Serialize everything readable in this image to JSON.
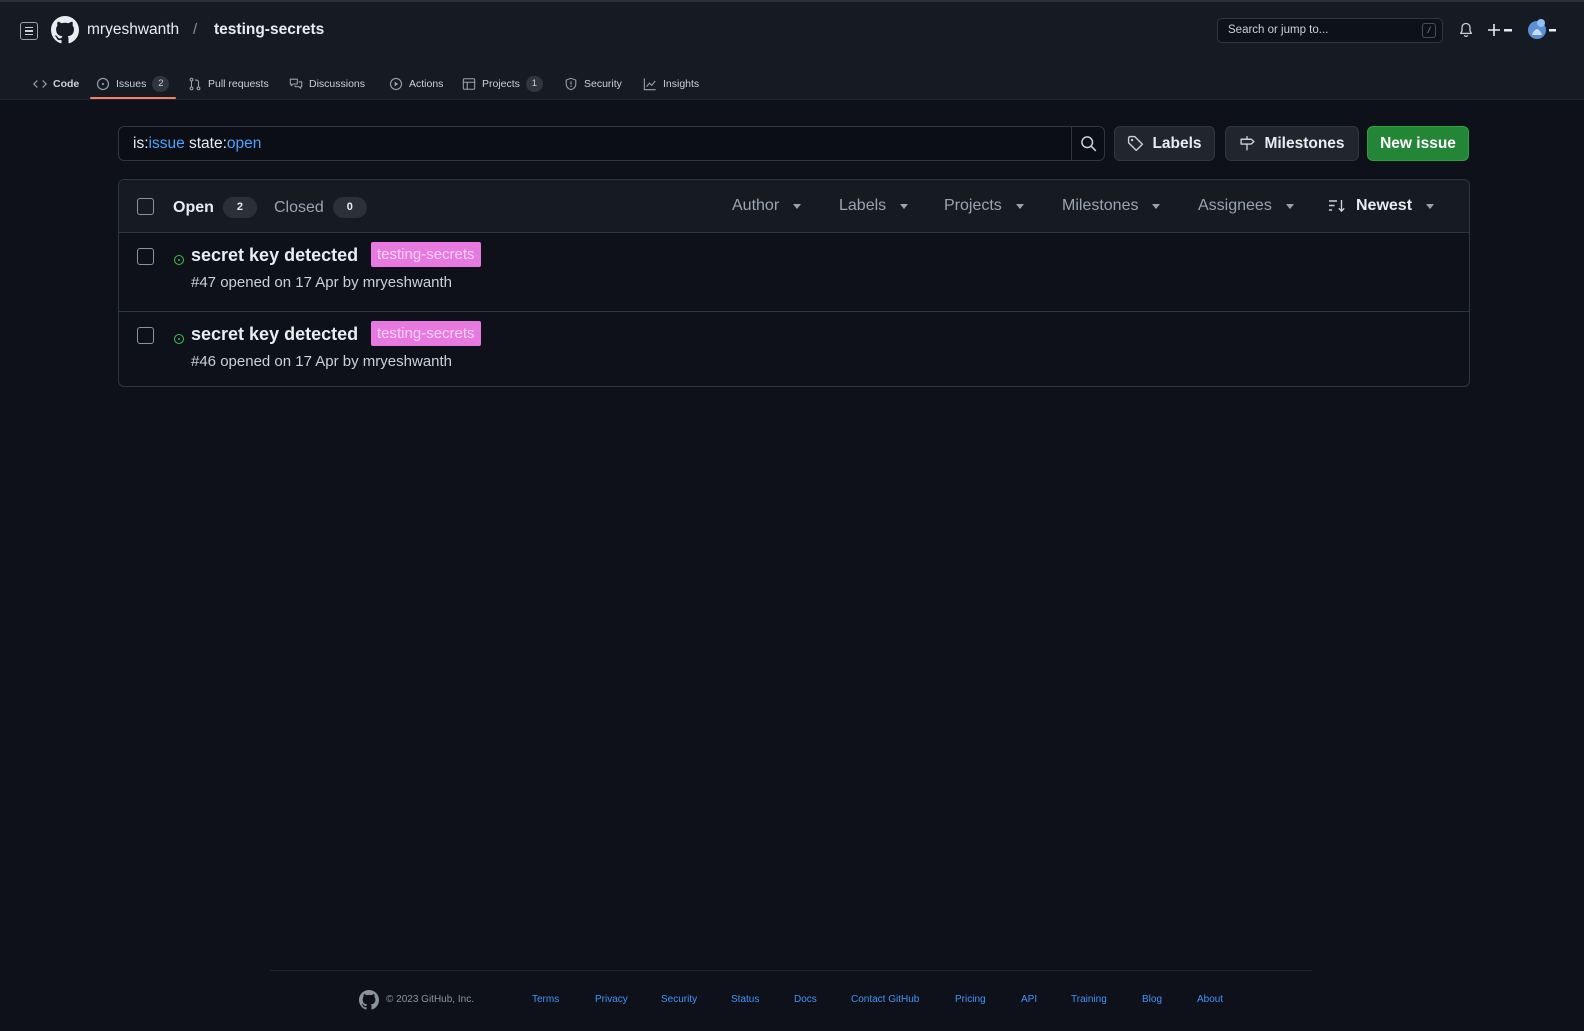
{
  "header": {
    "owner": "mryeshwanth",
    "separator": "/",
    "repo": "testing-secrets",
    "search_placeholder": "Search or jump to...",
    "search_shortcut": "/"
  },
  "repo_nav": {
    "tabs": [
      {
        "label": "Code",
        "icon": "code-icon"
      },
      {
        "label": "Issues",
        "icon": "issue-opened-icon",
        "count": "2",
        "selected": true
      },
      {
        "label": "Pull requests",
        "icon": "git-pull-request-icon"
      },
      {
        "label": "Discussions",
        "icon": "comment-discussion-icon"
      },
      {
        "label": "Actions",
        "icon": "play-icon"
      },
      {
        "label": "Projects",
        "icon": "table-icon",
        "count": "1"
      },
      {
        "label": "Security",
        "icon": "shield-icon"
      },
      {
        "label": "Insights",
        "icon": "graph-icon"
      }
    ]
  },
  "filter": {
    "query_prefix1": "is:",
    "query_kw1": "issue",
    "query_prefix2": " state:",
    "query_kw2": "open",
    "labels_button": "Labels",
    "milestones_button": "Milestones",
    "new_issue_button": "New issue"
  },
  "issues_header": {
    "open_label": "Open",
    "open_count": "2",
    "closed_label": "Closed",
    "closed_count": "0",
    "filters": {
      "author": "Author",
      "labels": "Labels",
      "projects": "Projects",
      "milestones": "Milestones",
      "assignees": "Assignees",
      "sort": "Newest"
    }
  },
  "issues": [
    {
      "title": "secret key detected",
      "label": "testing-secrets",
      "meta": "#47 opened on 17 Apr by mryeshwanth"
    },
    {
      "title": "secret key detected",
      "label": "testing-secrets",
      "meta": "#46 opened on 17 Apr by mryeshwanth"
    }
  ],
  "footer": {
    "copyright": "© 2023 GitHub, Inc.",
    "links": [
      "Terms",
      "Privacy",
      "Security",
      "Status",
      "Docs",
      "Contact GitHub",
      "Pricing",
      "API",
      "Training",
      "Blog",
      "About"
    ]
  },
  "colors": {
    "background": "#0e111a",
    "header": "#161a23",
    "accent_link": "#4493f8",
    "primary_button": "#238636",
    "label_bg": "#e879e0",
    "selected_tab_underline": "#f78166",
    "open_state": "#3fb950"
  }
}
